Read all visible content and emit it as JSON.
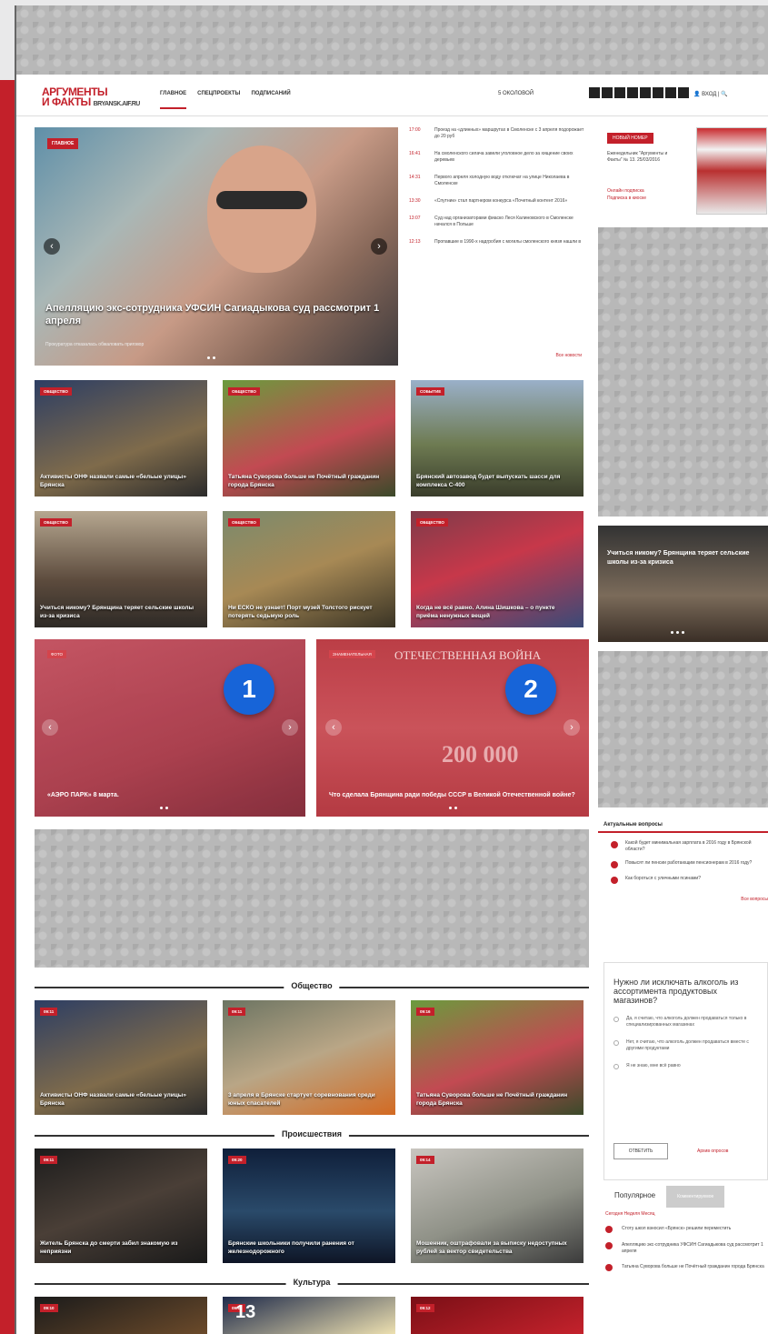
{
  "header": {
    "logo_line1": "АРГУМЕНТЫ",
    "logo_line2": "И ФАКТЫ",
    "logo_domain": "BRYANSK.AIF.RU",
    "nav": [
      "ГЛАВНОЕ",
      "СПЕЦПРОЕКТЫ",
      "ПОДПИСАНИЙ"
    ],
    "subscribe": "5 ОКОЛОВОЙ",
    "login": "ВХОД"
  },
  "hero": {
    "tag": "ГЛАВНОЕ",
    "title": "Апелляцию экс-сотрудника УФСИН Сагиадыкова суд рассмотрит 1 апреля",
    "caption": "Прокуратура отказалась обжаловать приговор"
  },
  "newsfeed": {
    "items": [
      {
        "time": "17:00",
        "text": "Проезд на «длинных» маршрутах в Смоленске с 3 апреля подорожает до 20 руб"
      },
      {
        "time": "16:41",
        "text": "На смоленского силача завели уголовное дело за хищение своих деревьев"
      },
      {
        "time": "14:31",
        "text": "Первого апреля холодную воду отключат на улице Николаева в Смоленске"
      },
      {
        "time": "13:30",
        "text": "«Спутник» стал партнером конкурса «Почетный контент 2016»"
      },
      {
        "time": "13:07",
        "text": "Суд над организаторами фиаско Леся Калиновского в Смоленске начался в Польше"
      },
      {
        "time": "12:13",
        "text": "Пропавшие в 1990-х надгробия с могилы смоленского князя нашли в"
      }
    ],
    "more": "Все новости"
  },
  "grid_row1": [
    {
      "tag": "ОБЩЕСТВО",
      "title": "Активисты ОНФ назвали самые «бельые улицы» Брянска"
    },
    {
      "tag": "ОБЩЕСТВО",
      "title": "Татьяна Суворова больше не Почётный гражданин города Брянска"
    },
    {
      "tag": "СОБЫТИЕ",
      "title": "Брянский автозавод будет выпускать шасси для комплекса С-400"
    }
  ],
  "grid_row2": [
    {
      "tag": "ОБЩЕСТВО",
      "title": "Учиться никому? Брянщина теряет сельские школы из-за кризиса"
    },
    {
      "tag": "ОБЩЕСТВО",
      "title": "Ни ЕСКО не узнает! Порт музей Толстого рискует потерять седьмую роль"
    },
    {
      "tag": "ОБЩЕСТВО",
      "title": "Когда не всё равно. Алина Шишкова – о пункте приёма ненужных вещей"
    }
  ],
  "promo": [
    {
      "tag": "ФОТО",
      "title": "«АЭРО ПАРК» 8 марта.",
      "badge": "1"
    },
    {
      "tag": "ЗНАМЕНАТЕЛЬНАЯ",
      "header": "ОТЕЧЕСТВЕННАЯ ВОЙНА",
      "amount": "200 000",
      "title": "Что сделала Брянщина ради победы СССР в Великой Отечественной войне?",
      "badge": "2"
    }
  ],
  "sections": [
    {
      "name": "Общество",
      "cards": [
        {
          "tag": "09:11",
          "title": "Активисты ОНФ назвали самые «бельые улицы» Брянска"
        },
        {
          "tag": "09:11",
          "title": "3 апреля в Брянске стартует соревнования среди юных спасателей"
        },
        {
          "tag": "09:16",
          "title": "Татьяна Суворова больше не Почётный гражданин города Брянска"
        }
      ]
    },
    {
      "name": "Происшествия",
      "cards": [
        {
          "tag": "09:11",
          "title": "Житель Брянска до смерти забил знакомую из неприязни"
        },
        {
          "tag": "09:20",
          "title": "Брянские школьники получили ранения от железнодорожного"
        },
        {
          "tag": "09:14",
          "title": "Мошенник, оштрафовали за выписку недоступных рублей за вектор свидетельства"
        }
      ]
    },
    {
      "name": "Культура",
      "cards": [
        {
          "tag": "09:10",
          "title": ""
        },
        {
          "tag": "09:11",
          "title": "13"
        },
        {
          "tag": "09:12",
          "title": ""
        }
      ]
    }
  ],
  "sidebar": {
    "magazine": {
      "tag": "НОВЫЙ НОМЕР",
      "text": "Еженедельник \"Аргументы и Факты\" № 13. 25/03/2016",
      "links": [
        "Онлайн подписка",
        "Подписка в киоске"
      ]
    },
    "slider_title": "Учиться никому? Брянщина теряет сельские школы из-за кризиса",
    "questions": {
      "title": "Актуальные вопросы",
      "items": [
        "Какой будет минимальная зарплата в 2016 году в Брянской области?",
        "Повысят ли пенсии работающим пенсионерам в 2016 году?",
        "Как бороться с уличными псинами?"
      ],
      "more": "Все вопросы"
    },
    "poll": {
      "question": "Нужно ли исключать алкоголь из ассортимента продуктовых магазинов?",
      "options": [
        "Да, я считаю, что алкоголь должен продаваться только в специализированных магазинах",
        "Нет, я считаю, что алкоголь должен продаваться вместе с другими продуктами",
        "Я не знаю, мне всё равно"
      ],
      "button": "ОТВЕТИТЬ",
      "all": "Архив опросов"
    },
    "popular": {
      "tab_active": "Популярное",
      "tab_inactive": "Комментируемое",
      "sub": "Сегодня  Неделя  Месяц",
      "items": [
        "Стоту школ взносил «Брянск» решили переместить",
        "Апелляцию экс-сотрудника УФСИН Сагиадыкова суд рассмотрит 1 апреля",
        "Татьяна Суворова больше не Почётный гражданин города Брянска"
      ]
    }
  }
}
